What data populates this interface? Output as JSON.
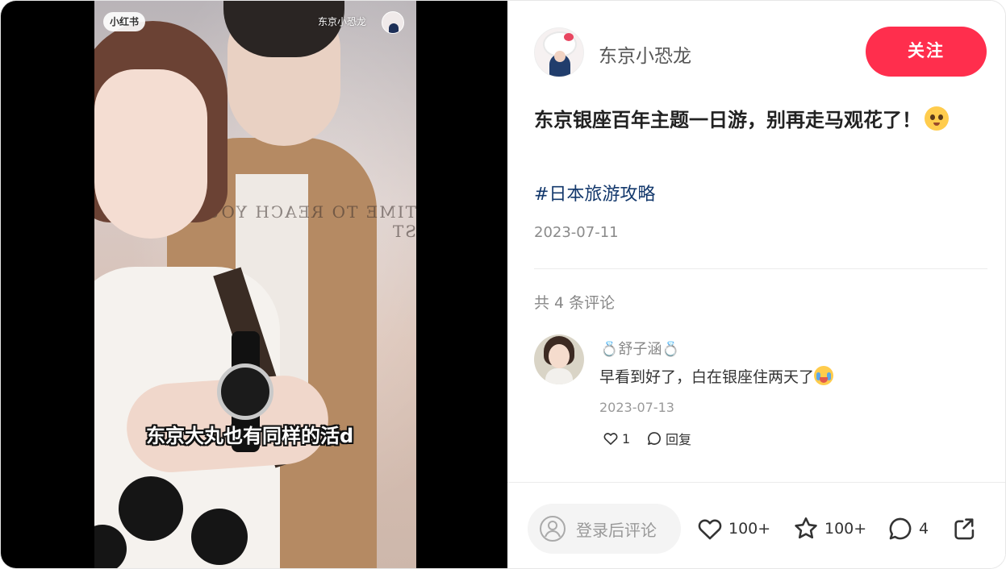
{
  "media": {
    "logo_badge": "小红书",
    "watermark_author": "东京小恐龙",
    "subtitle": "东京大丸也有同样的活d",
    "poster_text": "TIME TO REACH YOUR ST"
  },
  "author": {
    "name": "东京小恐龙",
    "follow_label": "关注"
  },
  "note": {
    "title": "东京银座百年主题一日游，别再走马观花了！",
    "tag": "#日本旅游攻略",
    "date": "2023-07-11"
  },
  "comments": {
    "count_label": "共 4 条评论",
    "items": [
      {
        "user": "舒子涵",
        "user_decoration": "💍",
        "text": "早看到好了，白在银座住两天了",
        "date": "2023-07-13",
        "likes": "1",
        "reply_label": "回复"
      }
    ]
  },
  "bottom_bar": {
    "login_placeholder": "登录后评论",
    "likes": "100+",
    "collects": "100+",
    "comments": "4"
  },
  "colors": {
    "accent": "#ff2e4d",
    "tag": "#13386c"
  },
  "icons": [
    "user-circle-icon",
    "heart-icon",
    "star-icon",
    "comment-icon",
    "share-icon",
    "reply-icon"
  ]
}
